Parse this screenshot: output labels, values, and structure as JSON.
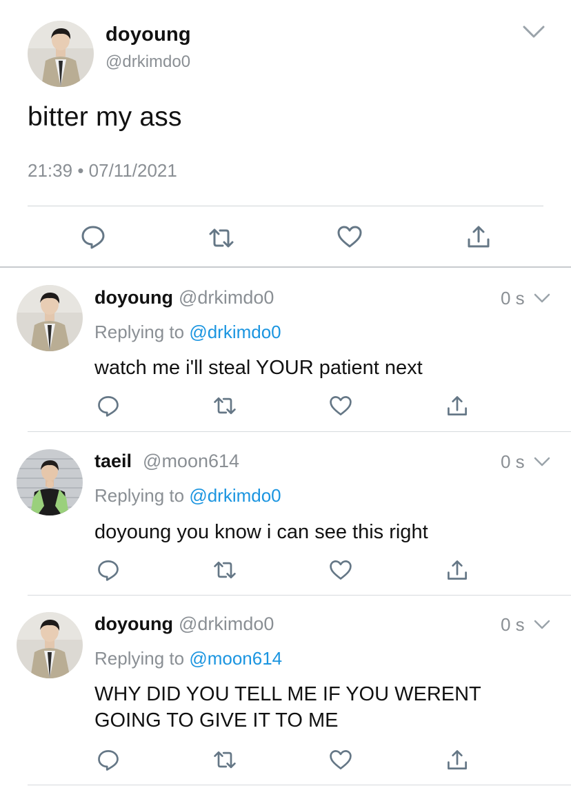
{
  "main_tweet": {
    "display_name": "doyoung",
    "handle": "@drkimdo0",
    "text": "bitter my ass",
    "time": "21:39",
    "separator": "•",
    "date": "07/11/2021",
    "avatar": "avatar-suit-icon",
    "actions": [
      "reply-icon",
      "retweet-icon",
      "like-icon",
      "share-icon"
    ]
  },
  "replies": [
    {
      "display_name": "doyoung",
      "handle": "@drkimdo0",
      "time": "0 s",
      "replying_prefix": "Replying to ",
      "replying_to": "@drkimdo0",
      "text": "watch me i'll steal YOUR patient next",
      "avatar": "avatar-suit-icon"
    },
    {
      "display_name": "taeil",
      "handle": "@moon614",
      "time": "0 s",
      "replying_prefix": "Replying to ",
      "replying_to": "@drkimdo0",
      "text": "doyoung you know i can see this right",
      "avatar": "avatar-green-jacket-icon"
    },
    {
      "display_name": "doyoung",
      "handle": "@drkimdo0",
      "time": "0 s",
      "replying_prefix": "Replying to ",
      "replying_to": "@moon614",
      "text": "WHY DID YOU TELL ME IF YOU WERENT GOING TO GIVE IT TO ME",
      "avatar": "avatar-suit-icon"
    }
  ],
  "colors": {
    "link": "#1b95e0",
    "secondary_text": "#8a8f94",
    "icon": "#657786",
    "divider": "#d6dadd"
  }
}
